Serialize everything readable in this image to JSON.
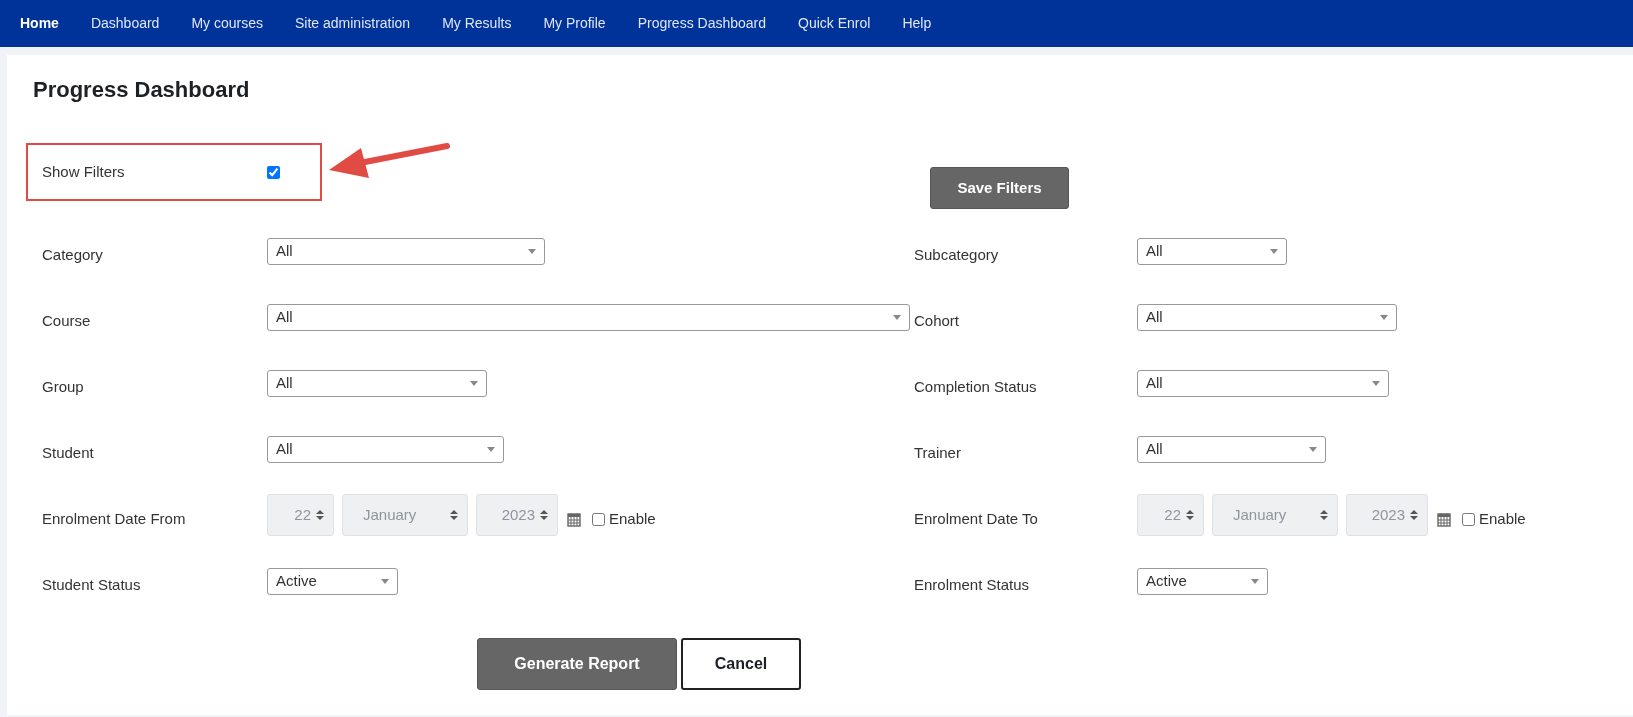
{
  "nav": [
    {
      "label": "Home",
      "selected": true
    },
    {
      "label": "Dashboard",
      "selected": false
    },
    {
      "label": "My courses",
      "selected": false
    },
    {
      "label": "Site administration",
      "selected": false
    },
    {
      "label": "My Results",
      "selected": false
    },
    {
      "label": "My Profile",
      "selected": false
    },
    {
      "label": "Progress Dashboard",
      "selected": false
    },
    {
      "label": "Quick Enrol",
      "selected": false
    },
    {
      "label": "Help",
      "selected": false
    }
  ],
  "page_title": "Progress Dashboard",
  "show_filters": {
    "label": "Show Filters",
    "checked": true,
    "highlighted": true
  },
  "save_button": "Save Filters",
  "left_filters": [
    {
      "kind": "select",
      "label": "Category",
      "value": "All"
    },
    {
      "kind": "select",
      "label": "Course",
      "value": "All"
    },
    {
      "kind": "select",
      "label": "Group",
      "value": "All"
    },
    {
      "kind": "select",
      "label": "Student",
      "value": "All"
    },
    {
      "kind": "date",
      "label": "Enrolment Date From",
      "day": "22",
      "month": "January",
      "year": "2023",
      "disabled": true,
      "enable": {
        "label": "Enable",
        "checked": false
      }
    },
    {
      "kind": "select",
      "label": "Student Status",
      "value": "Active"
    }
  ],
  "right_filters": [
    {
      "kind": "select",
      "label": "Subcategory",
      "value": "All"
    },
    {
      "kind": "select",
      "label": "Cohort",
      "value": "All"
    },
    {
      "kind": "select",
      "label": "Completion Status",
      "value": "All"
    },
    {
      "kind": "select",
      "label": "Trainer",
      "value": "All"
    },
    {
      "kind": "date",
      "label": "Enrolment Date To",
      "day": "22",
      "month": "January",
      "year": "2023",
      "disabled": true,
      "enable": {
        "label": "Enable",
        "checked": false
      }
    },
    {
      "kind": "select",
      "label": "Enrolment Status",
      "value": "Active"
    }
  ],
  "buttons": [
    {
      "label": "Generate Report",
      "kind": "primary"
    },
    {
      "label": "Cancel",
      "kind": "secondary"
    }
  ]
}
